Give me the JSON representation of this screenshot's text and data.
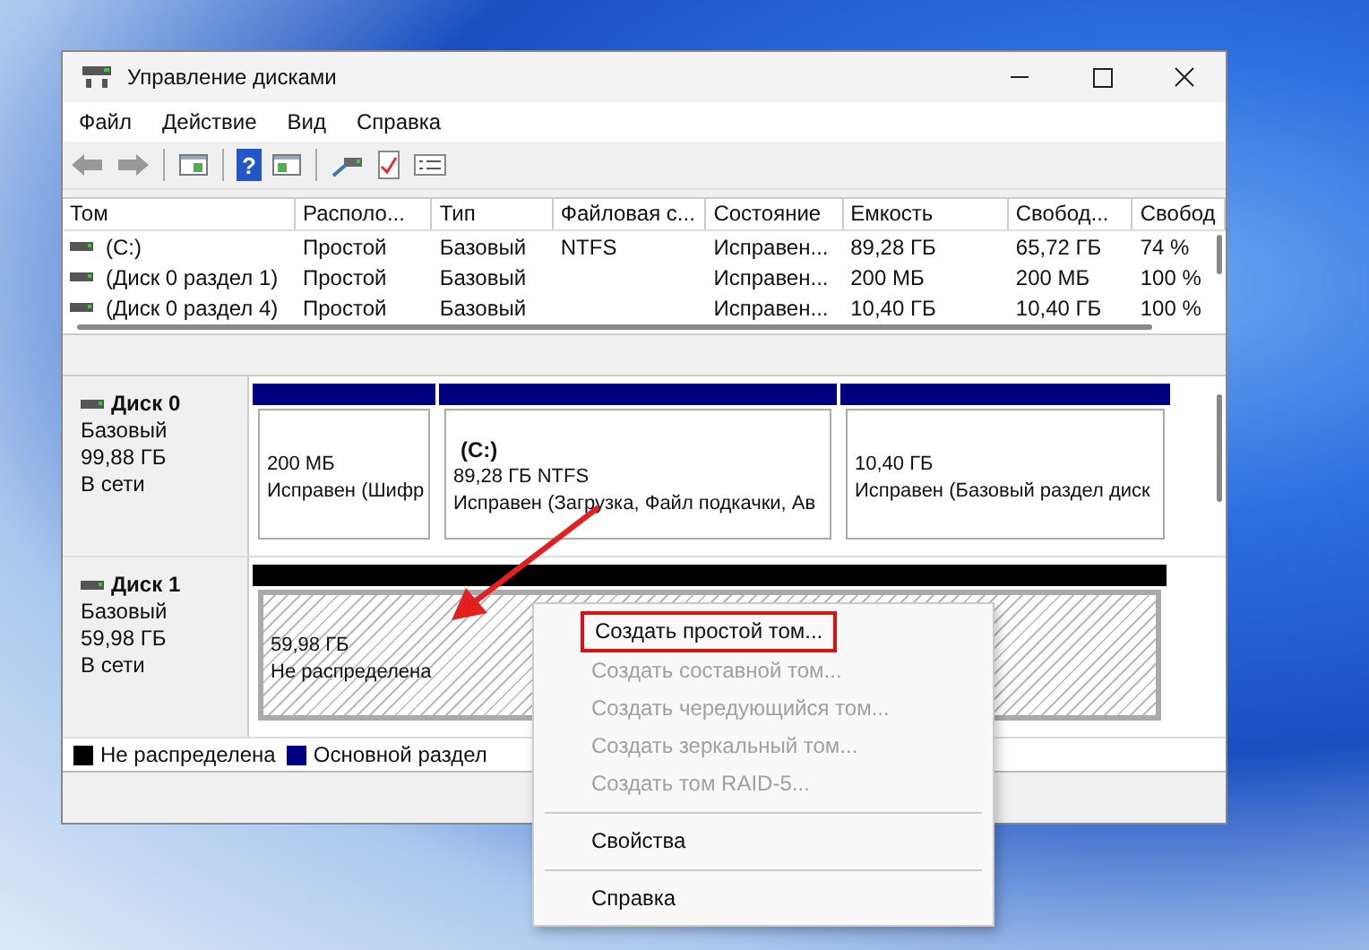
{
  "window": {
    "title": "Управление дисками"
  },
  "menu_bar": [
    "Файл",
    "Действие",
    "Вид",
    "Справка"
  ],
  "toolbar": {
    "help_glyph": "?"
  },
  "volume_table": {
    "columns": [
      "Том",
      "Располо...",
      "Тип",
      "Файловая с...",
      "Состояние",
      "Емкость",
      "Свобод...",
      "Свобод"
    ],
    "rows": [
      [
        "(C:)",
        "Простой",
        "Базовый",
        "NTFS",
        "Исправен...",
        "89,28 ГБ",
        "65,72 ГБ",
        "74 %"
      ],
      [
        "(Диск 0 раздел 1)",
        "Простой",
        "Базовый",
        "",
        "Исправен...",
        "200 МБ",
        "200 МБ",
        "100 %"
      ],
      [
        "(Диск 0 раздел 4)",
        "Простой",
        "Базовый",
        "",
        "Исправен...",
        "10,40 ГБ",
        "10,40 ГБ",
        "100 %"
      ]
    ]
  },
  "disks": [
    {
      "name": "Диск 0",
      "type": "Базовый",
      "size": "99,88 ГБ",
      "status": "В сети",
      "partitions": [
        {
          "kind": "primary",
          "selected": false,
          "size": "200 МБ",
          "status": "Исправен (Шифр"
        },
        {
          "kind": "primary",
          "selected": false,
          "label": "(C:)",
          "size": "89,28 ГБ NTFS",
          "status": "Исправен (Загрузка, Файл подкачки, Ав"
        },
        {
          "kind": "primary",
          "selected": false,
          "size": "10,40 ГБ",
          "status": "Исправен (Базовый раздел диск"
        }
      ]
    },
    {
      "name": "Диск 1",
      "type": "Базовый",
      "size": "59,98 ГБ",
      "status": "В сети",
      "partitions": [
        {
          "kind": "unallocated",
          "selected": true,
          "size": "59,98 ГБ",
          "status": "Не распределена"
        }
      ]
    }
  ],
  "legend": [
    {
      "kind": "unallocated",
      "label": "Не распределена",
      "color": "#000000"
    },
    {
      "kind": "primary",
      "label": "Основной раздел",
      "color": "#000080"
    }
  ],
  "context_menu": {
    "groups": [
      [
        {
          "label": "Создать простой том...",
          "disabled": false,
          "highlighted": true
        },
        {
          "label": "Создать составной том...",
          "disabled": true,
          "highlighted": false
        },
        {
          "label": "Создать чередующийся том...",
          "disabled": true,
          "highlighted": false
        },
        {
          "label": "Создать зеркальный том...",
          "disabled": true,
          "highlighted": false
        },
        {
          "label": "Создать том RAID-5...",
          "disabled": true,
          "highlighted": false
        }
      ],
      [
        {
          "label": "Свойства",
          "disabled": false,
          "highlighted": false
        }
      ],
      [
        {
          "label": "Справка",
          "disabled": false,
          "highlighted": false
        }
      ]
    ]
  }
}
